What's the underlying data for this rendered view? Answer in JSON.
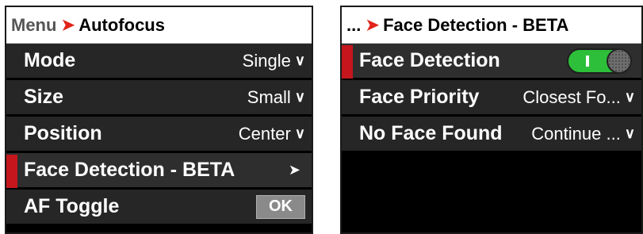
{
  "left": {
    "breadcrumb": {
      "root": "Menu",
      "separator": "➤",
      "current": "Autofocus"
    },
    "rows": [
      {
        "label": "Mode",
        "value": "Single",
        "chevron": "∨"
      },
      {
        "label": "Size",
        "value": "Small",
        "chevron": "∨"
      },
      {
        "label": "Position",
        "value": "Center",
        "chevron": "∨"
      },
      {
        "label": "Face Detection - BETA",
        "arrow": "➤"
      },
      {
        "label": "AF Toggle",
        "button": "OK"
      }
    ]
  },
  "right": {
    "breadcrumb": {
      "root": "...",
      "separator": "➤",
      "current": "Face Detection - BETA"
    },
    "rows": [
      {
        "label": "Face Detection",
        "toggle_on": true
      },
      {
        "label": "Face Priority",
        "value": "Closest Fo...",
        "chevron": "∨"
      },
      {
        "label": "No Face Found",
        "value": "Continue ...",
        "chevron": "∨"
      }
    ]
  },
  "colors": {
    "accent": "#e2231a",
    "selection": "#c4161c",
    "toggle_on": "#2dbf3a",
    "row_bg": "#262626"
  }
}
